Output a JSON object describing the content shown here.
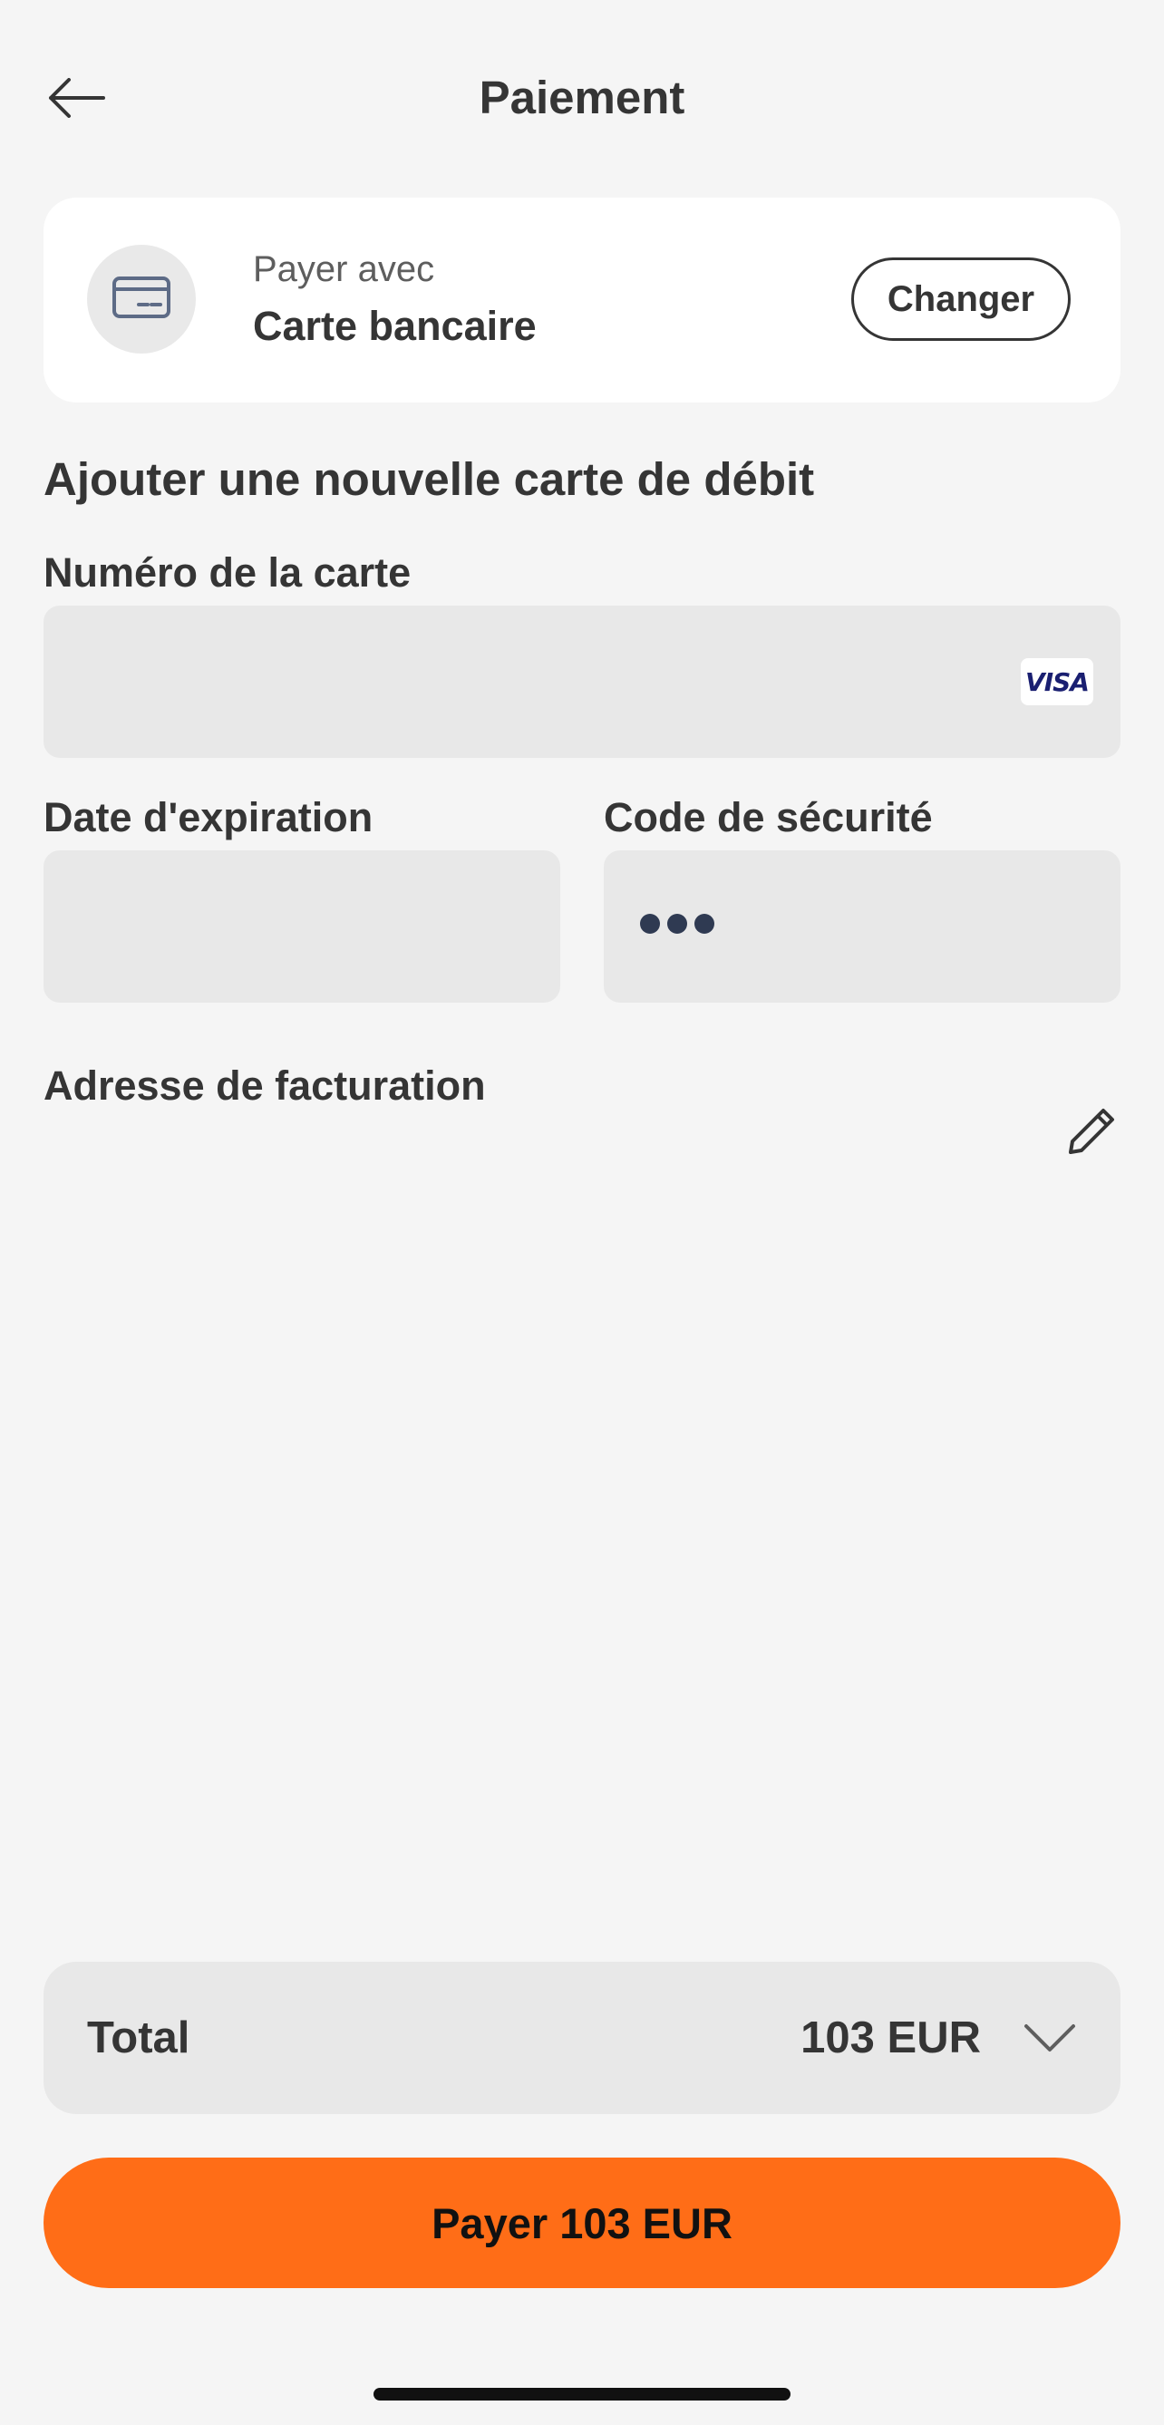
{
  "header": {
    "title": "Paiement",
    "back_icon": "arrow-left-icon"
  },
  "payment_method": {
    "caption": "Payer avec",
    "name": "Carte bancaire",
    "icon": "credit-card-icon",
    "change_label": "Changer"
  },
  "form": {
    "section_title": "Ajouter une nouvelle carte de débit",
    "card_number": {
      "label": "Numéro de la carte",
      "value": "",
      "brand": "VISA"
    },
    "expiry": {
      "label": "Date d'expiration",
      "value": ""
    },
    "security_code": {
      "label": "Code de sécurité",
      "placeholder": "•••"
    },
    "billing": {
      "label": "Adresse de facturation",
      "edit_icon": "pencil-icon"
    }
  },
  "summary": {
    "total_label": "Total",
    "total_amount": "103 EUR",
    "expand_icon": "chevron-down-icon"
  },
  "pay_button": {
    "label": "Payer 103 EUR"
  },
  "colors": {
    "accent": "#ff6d17",
    "background": "#f5f5f5",
    "field": "#e8e8e8",
    "text": "#353535"
  }
}
